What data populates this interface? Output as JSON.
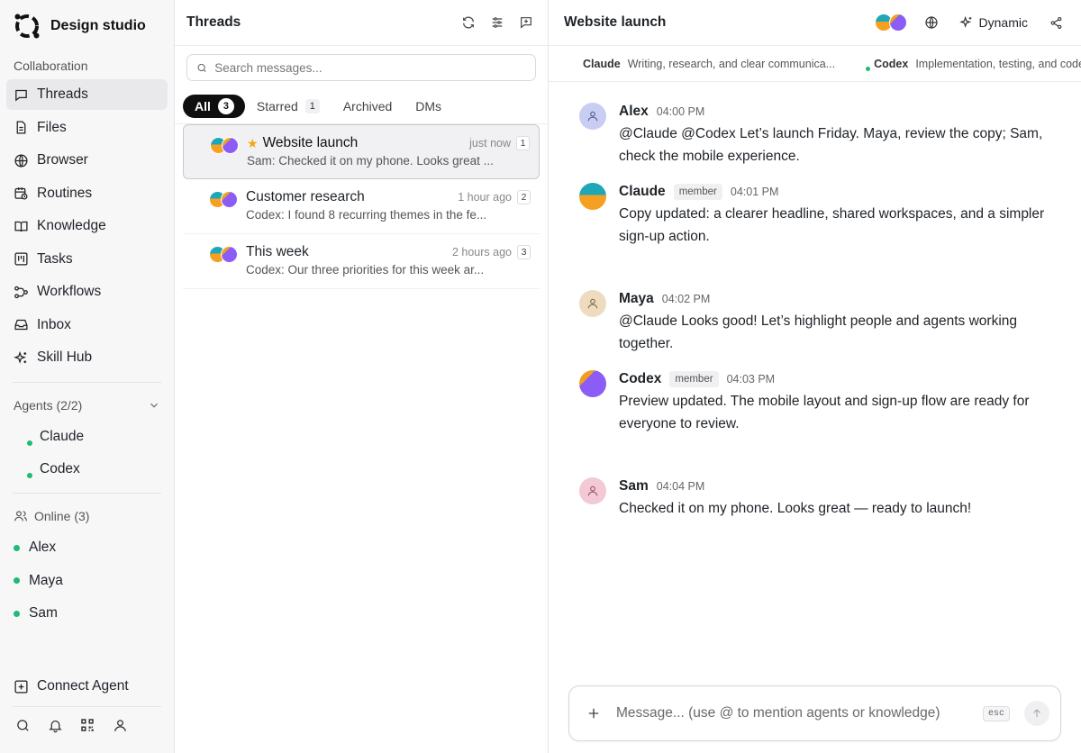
{
  "workspace": {
    "name": "Design studio"
  },
  "sidebar": {
    "section_label": "Collaboration",
    "items": [
      {
        "label": "Threads",
        "icon": "threads-icon"
      },
      {
        "label": "Files",
        "icon": "file-icon"
      },
      {
        "label": "Browser",
        "icon": "globe-icon"
      },
      {
        "label": "Routines",
        "icon": "calendar-clock-icon"
      },
      {
        "label": "Knowledge",
        "icon": "book-icon"
      },
      {
        "label": "Tasks",
        "icon": "kanban-icon"
      },
      {
        "label": "Workflows",
        "icon": "workflow-icon"
      },
      {
        "label": "Inbox",
        "icon": "inbox-icon"
      },
      {
        "label": "Skill Hub",
        "icon": "sparkles-icon"
      }
    ],
    "agents_label": "Agents (2/2)",
    "agents": [
      {
        "name": "Claude"
      },
      {
        "name": "Codex"
      }
    ],
    "online_label": "Online (3)",
    "online_users": [
      {
        "name": "Alex"
      },
      {
        "name": "Maya"
      },
      {
        "name": "Sam"
      }
    ],
    "connect_label": "Connect Agent"
  },
  "threads": {
    "title": "Threads",
    "search_placeholder": "Search messages...",
    "tabs": [
      {
        "label": "All",
        "count": "3"
      },
      {
        "label": "Starred",
        "count": "1"
      },
      {
        "label": "Archived"
      },
      {
        "label": "DMs"
      }
    ],
    "items": [
      {
        "title": "Website launch",
        "time": "just now",
        "count": "1",
        "preview": "Sam: Checked it on my phone. Looks great ...",
        "starred": true
      },
      {
        "title": "Customer research",
        "time": "1 hour ago",
        "count": "2",
        "preview": "Codex: I found 8 recurring themes in the fe..."
      },
      {
        "title": "This week",
        "time": "2 hours ago",
        "count": "3",
        "preview": "Codex: Our three priorities for this week ar..."
      }
    ]
  },
  "chat": {
    "title": "Website launch",
    "mode_label": "Dynamic",
    "agents_bar": [
      {
        "name": "Claude",
        "desc": "Writing, research, and clear communica..."
      },
      {
        "name": "Codex",
        "desc": "Implementation, testing, and code"
      }
    ],
    "messages": [
      {
        "author": "Alex",
        "time": "04:00 PM",
        "text": "@Claude @Codex Let’s launch Friday. Maya, review the copy; Sam, check the mobile experience."
      },
      {
        "author": "Claude",
        "badge": "member",
        "time": "04:01 PM",
        "text": "Copy updated: a clearer headline, shared workspaces, and a simpler sign-up action."
      },
      {
        "author": "Maya",
        "time": "04:02 PM",
        "text": "@Claude Looks good! Let’s highlight people and agents working together."
      },
      {
        "author": "Codex",
        "badge": "member",
        "time": "04:03 PM",
        "text": "Preview updated. The mobile layout and sign-up flow are ready for everyone to review."
      },
      {
        "author": "Sam",
        "time": "04:04 PM",
        "text": "Checked it on my phone. Looks great — ready to launch!"
      }
    ],
    "composer_placeholder": "Message... (use @ to mention agents or knowledge)",
    "esc_label": "esc"
  },
  "colors": {
    "online": "#1fba73",
    "alex_avatar": "#c9cdf2",
    "maya_avatar": "#eedcc0",
    "sam_avatar": "#f2c9d4"
  }
}
